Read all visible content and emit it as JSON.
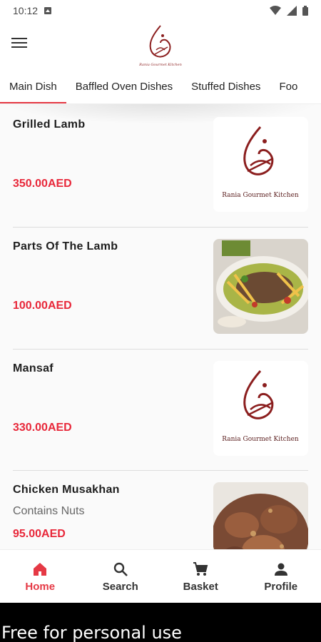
{
  "status_bar": {
    "time": "10:12"
  },
  "logo": {
    "caption": "Rania Gourmet Kitchen"
  },
  "tabs": [
    {
      "label": "Main Dish"
    },
    {
      "label": "Baffled Oven Dishes"
    },
    {
      "label": "Stuffed Dishes"
    },
    {
      "label": "Foo"
    }
  ],
  "items": [
    {
      "name": "Grilled Lamb",
      "note": "",
      "price": "350.00AED",
      "image": "logo"
    },
    {
      "name": "Parts Of The Lamb",
      "note": "",
      "price": "100.00AED",
      "image": "lamb-photo"
    },
    {
      "name": "Mansaf",
      "note": "",
      "price": "330.00AED",
      "image": "logo"
    },
    {
      "name": "Chicken Musakhan",
      "note": "Contains Nuts",
      "price": "95.00AED",
      "image": "chicken-photo"
    }
  ],
  "bottom_nav": [
    {
      "label": "Home",
      "icon": "home-icon"
    },
    {
      "label": "Search",
      "icon": "search-icon"
    },
    {
      "label": "Basket",
      "icon": "cart-icon"
    },
    {
      "label": "Profile",
      "icon": "person-icon"
    }
  ],
  "footer": {
    "text": "Free for personal use"
  },
  "colors": {
    "accent": "#e53945",
    "price": "#e8283a",
    "logo": "#8b1e1e"
  }
}
